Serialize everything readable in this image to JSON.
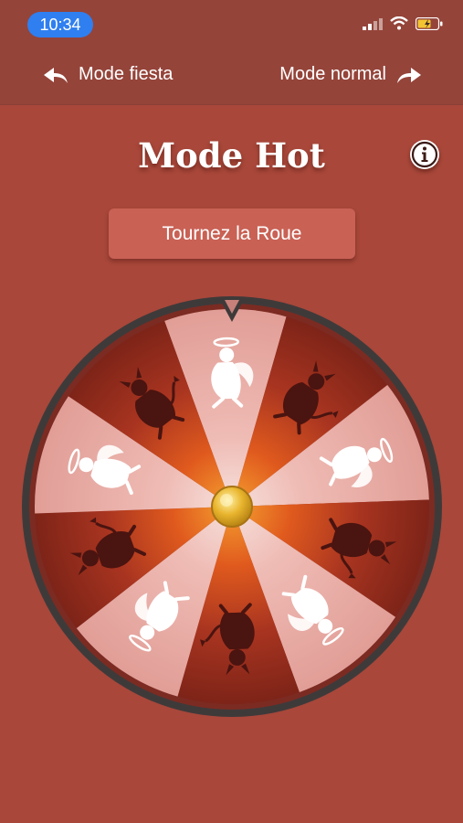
{
  "status_bar": {
    "time": "10:34",
    "icons": [
      "signal-icon",
      "wifi-icon",
      "battery-charging-icon"
    ]
  },
  "nav": {
    "left_label": "Mode fiesta",
    "right_label": "Mode normal",
    "left_icon": "back-arrow-icon",
    "right_icon": "forward-arrow-icon"
  },
  "header": {
    "title": "Mode Hot",
    "info_icon": "info-icon"
  },
  "spin_button": {
    "label": "Tournez la Roue"
  },
  "wheel": {
    "segments": [
      "angel",
      "devil",
      "angel",
      "devil",
      "angel",
      "devil",
      "angel",
      "devil",
      "angel",
      "devil"
    ],
    "colors": {
      "background": "#a8473a",
      "angel_segment": "#e6a8a2",
      "devil_segment": "#8a2a20",
      "rim": "#3f3a3a",
      "hub": "#e8b530"
    }
  }
}
